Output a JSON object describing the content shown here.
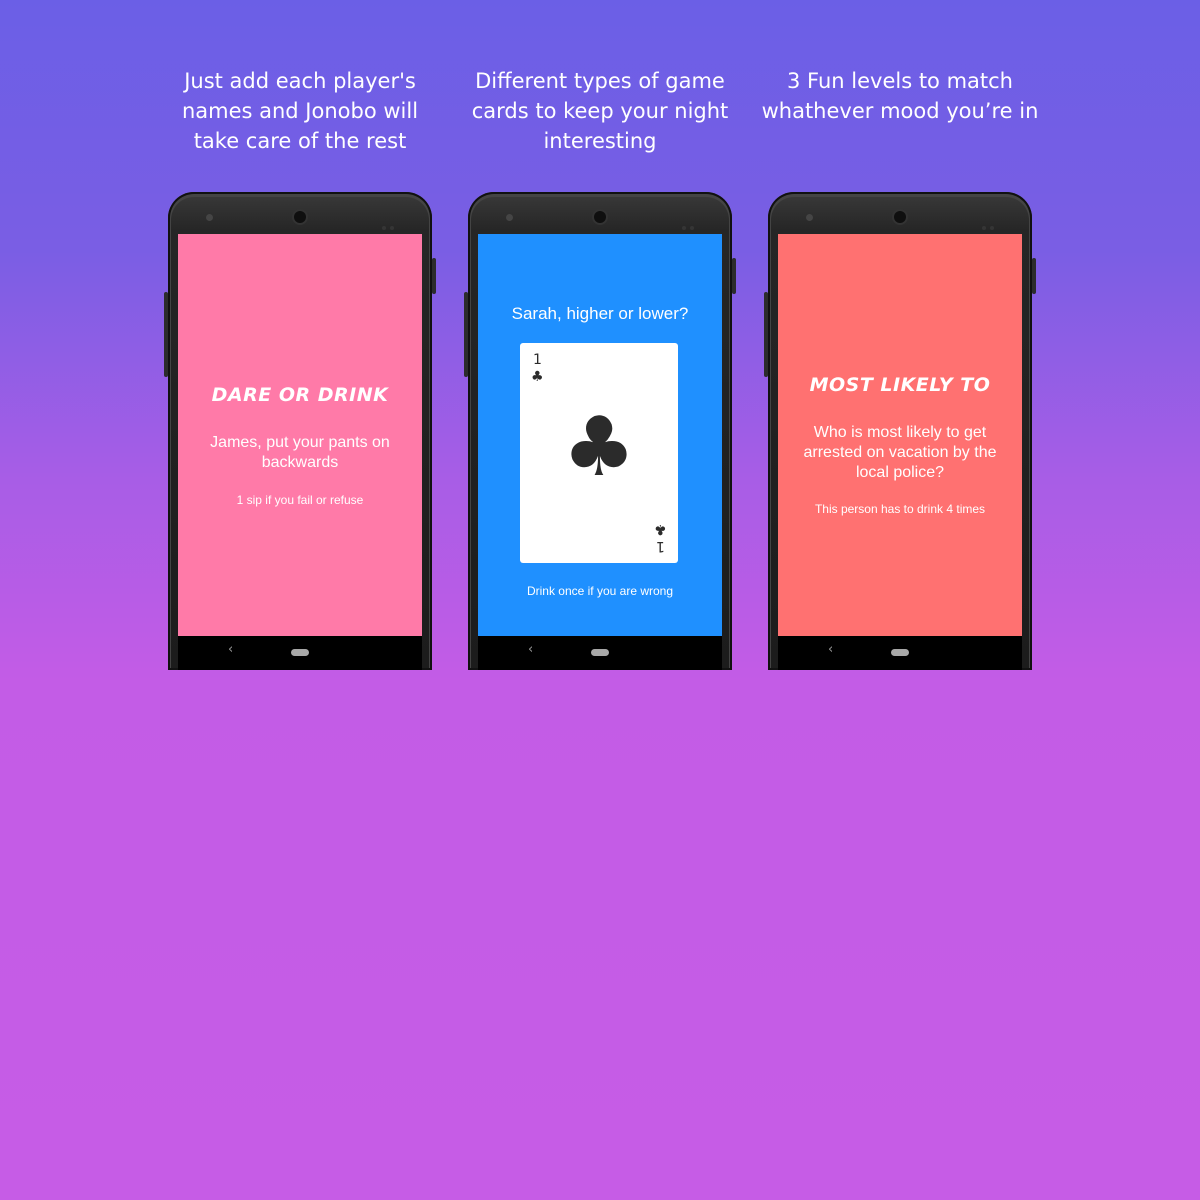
{
  "captions": [
    "Just add each player's names and Jonobo will take care of the rest",
    "Different types of game cards to keep your night interesting",
    "3 Fun levels to match whathever mood you’re in"
  ],
  "phones": [
    {
      "screen_color": "#ff7aa8",
      "title": "DARE OR DRINK",
      "body": "James, put your pants on backwards",
      "note": "1 sip if you fail or refuse"
    },
    {
      "screen_color": "#1f90ff",
      "prompt": "Sarah, higher or lower?",
      "card": {
        "rank": "1",
        "suit_icon": "club-icon",
        "suit_glyph": "♣"
      },
      "note": "Drink once if you are wrong"
    },
    {
      "screen_color": "#ff7171",
      "title": "MOST LIKELY TO",
      "body": "Who is most likely to get arrested on vacation by the local police?",
      "note": "This person has to drink 4 times"
    }
  ],
  "navbar": {
    "back_glyph": "‹"
  }
}
